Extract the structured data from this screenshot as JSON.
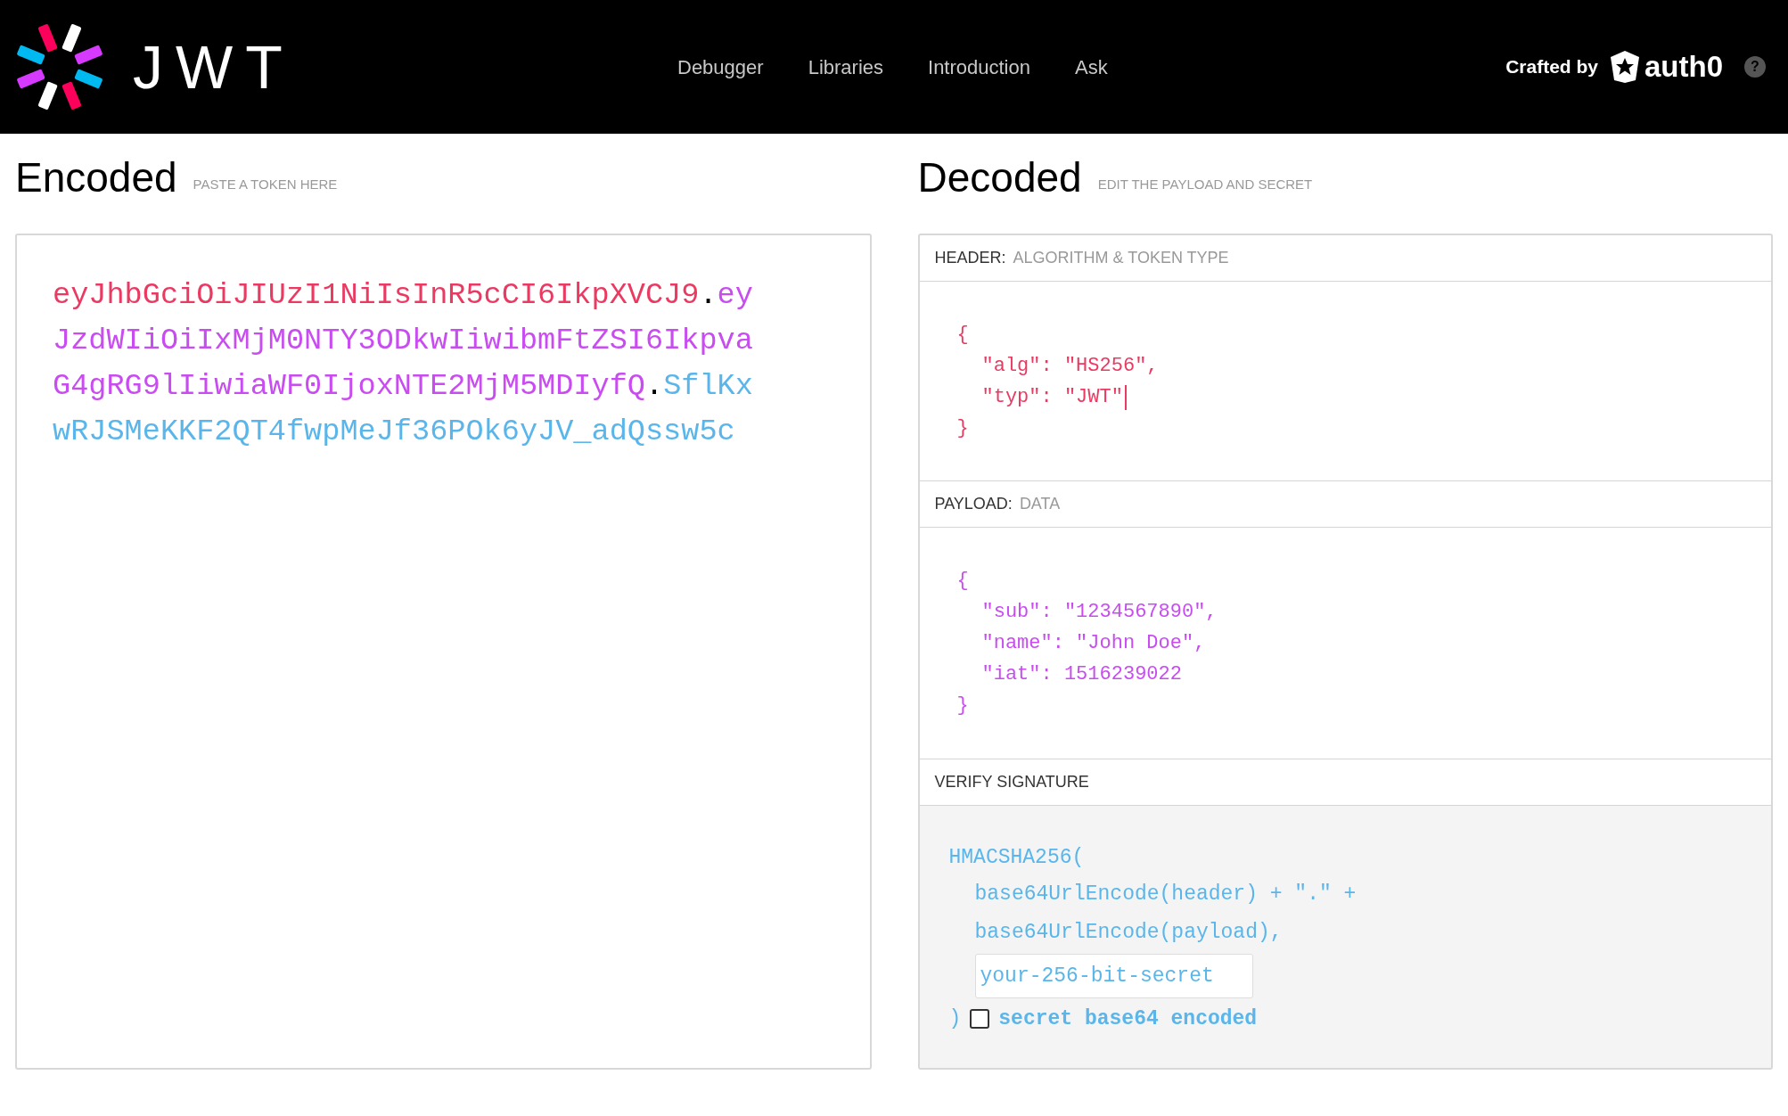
{
  "navbar": {
    "logo_text": "JWT",
    "links": [
      {
        "label": "Debugger"
      },
      {
        "label": "Libraries"
      },
      {
        "label": "Introduction"
      },
      {
        "label": "Ask"
      }
    ],
    "crafted_by": "Crafted by",
    "brand": "auth0",
    "help": "?"
  },
  "encoded": {
    "title": "Encoded",
    "hint": "PASTE A TOKEN HERE",
    "token_lines": [
      [
        {
          "text": "eyJhbGciOiJIUzI1NiIsInR5cCI6IkpXVCJ9",
          "color": "#ea3a62"
        },
        {
          "text": ".",
          "color": "#000000"
        },
        {
          "text": "ey",
          "color": "#c84cf0"
        }
      ],
      [
        {
          "text": "JzdWIiOiIxMjM0NTY3ODkwIiwibmFtZSI6Ikpva",
          "color": "#c84cf0"
        }
      ],
      [
        {
          "text": "G4gRG9lIiwiaWF0IjoxNTE2MjM5MDIyfQ",
          "color": "#c84cf0"
        },
        {
          "text": ".",
          "color": "#000000"
        },
        {
          "text": "SflKx",
          "color": "#5ab6ea"
        }
      ],
      [
        {
          "text": "wRJSMeKKF2QT4fwpMeJf36POk6yJV_adQssw5c",
          "color": "#5ab6ea"
        }
      ]
    ]
  },
  "decoded": {
    "title": "Decoded",
    "hint": "EDIT THE PAYLOAD AND SECRET",
    "header": {
      "label": "HEADER:",
      "sublabel": "ALGORITHM & TOKEN TYPE",
      "open": "{",
      "entries": [
        "\"alg\": \"HS256\",",
        "\"typ\": \"JWT\""
      ],
      "close": "}"
    },
    "payload": {
      "label": "PAYLOAD:",
      "sublabel": "DATA",
      "open": "{",
      "entries": [
        "\"sub\": \"1234567890\",",
        "\"name\": \"John Doe\",",
        "\"iat\": 1516239022"
      ],
      "close": "}"
    },
    "verify": {
      "label": "VERIFY SIGNATURE",
      "function": "HMACSHA256(",
      "args": [
        "base64UrlEncode(header) + \".\" +",
        "base64UrlEncode(payload),"
      ],
      "secret_placeholder": "your-256-bit-secret",
      "close": ")",
      "checkbox": {
        "label": "secret base64 encoded",
        "checked": false
      }
    }
  }
}
